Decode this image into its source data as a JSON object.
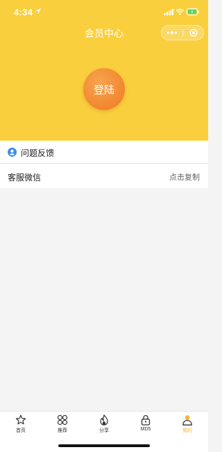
{
  "status_bar": {
    "time": "4:34"
  },
  "header": {
    "title": "会员中心",
    "login_label": "登陆",
    "bg_color": "#f9cf3d"
  },
  "menu": {
    "feedback": {
      "label": "问题反馈",
      "icon": "user-circle-icon"
    },
    "wechat": {
      "label": "客服微信",
      "action": "点击复制"
    }
  },
  "tabbar": {
    "active_color": "#f3b53a",
    "tabs": [
      {
        "label": "首页",
        "icon": "star-icon"
      },
      {
        "label": "推荐",
        "icon": "grid-icon"
      },
      {
        "label": "分享",
        "icon": "flame-icon"
      },
      {
        "label": "MD5",
        "icon": "lock-icon"
      },
      {
        "label": "我的",
        "icon": "profile-icon",
        "active": true
      }
    ]
  }
}
